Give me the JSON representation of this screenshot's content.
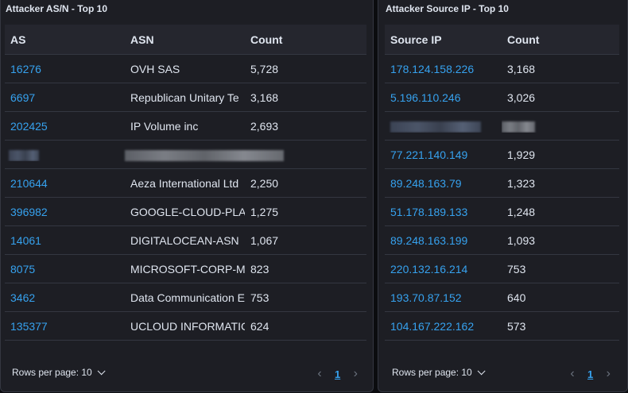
{
  "asn_panel": {
    "title": "Attacker AS/N - Top 10",
    "columns": [
      "AS",
      "ASN",
      "Count"
    ],
    "rows": [
      {
        "as": "16276",
        "asn": "OVH SAS",
        "count": "5,728"
      },
      {
        "as": "6697",
        "asn": "Republican Unitary Te",
        "count": "3,168"
      },
      {
        "as": "202425",
        "asn": "IP Volume inc",
        "count": "2,693"
      },
      {
        "as": "",
        "asn": "",
        "count": "",
        "redacted": true
      },
      {
        "as": "210644",
        "asn": "Aeza International Ltd",
        "count": "2,250"
      },
      {
        "as": "396982",
        "asn": "GOOGLE-CLOUD-PLA",
        "count": "1,275"
      },
      {
        "as": "14061",
        "asn": "DIGITALOCEAN-ASN",
        "count": "1,067"
      },
      {
        "as": "8075",
        "asn": "MICROSOFT-CORP-M",
        "count": "823"
      },
      {
        "as": "3462",
        "asn": "Data Communication E",
        "count": "753"
      },
      {
        "as": "135377",
        "asn": "UCLOUD INFORMATIC",
        "count": "624"
      }
    ],
    "rows_per_page_label": "Rows per page: 10",
    "current_page": "1"
  },
  "ip_panel": {
    "title": "Attacker Source IP - Top 10",
    "columns": [
      "Source IP",
      "Count"
    ],
    "rows": [
      {
        "ip": "178.124.158.226",
        "count": "3,168"
      },
      {
        "ip": "5.196.110.246",
        "count": "3,026"
      },
      {
        "ip": "",
        "count": "",
        "redacted": true
      },
      {
        "ip": "77.221.140.149",
        "count": "1,929"
      },
      {
        "ip": "89.248.163.79",
        "count": "1,323"
      },
      {
        "ip": "51.178.189.133",
        "count": "1,248"
      },
      {
        "ip": "89.248.163.199",
        "count": "1,093"
      },
      {
        "ip": "220.132.16.214",
        "count": "753"
      },
      {
        "ip": "193.70.87.152",
        "count": "640"
      },
      {
        "ip": "104.167.222.162",
        "count": "573"
      }
    ],
    "rows_per_page_label": "Rows per page: 10",
    "current_page": "1"
  },
  "colors": {
    "background": "#0b0c0f",
    "panel": "#1d1e24",
    "header_row": "#25262e",
    "link": "#36a2ef",
    "text": "#dfe5ef",
    "border": "#343741"
  },
  "icons": {
    "rows_dropdown": "chevron-down-icon",
    "prev_page": "chevron-left-icon",
    "next_page": "chevron-right-icon"
  }
}
